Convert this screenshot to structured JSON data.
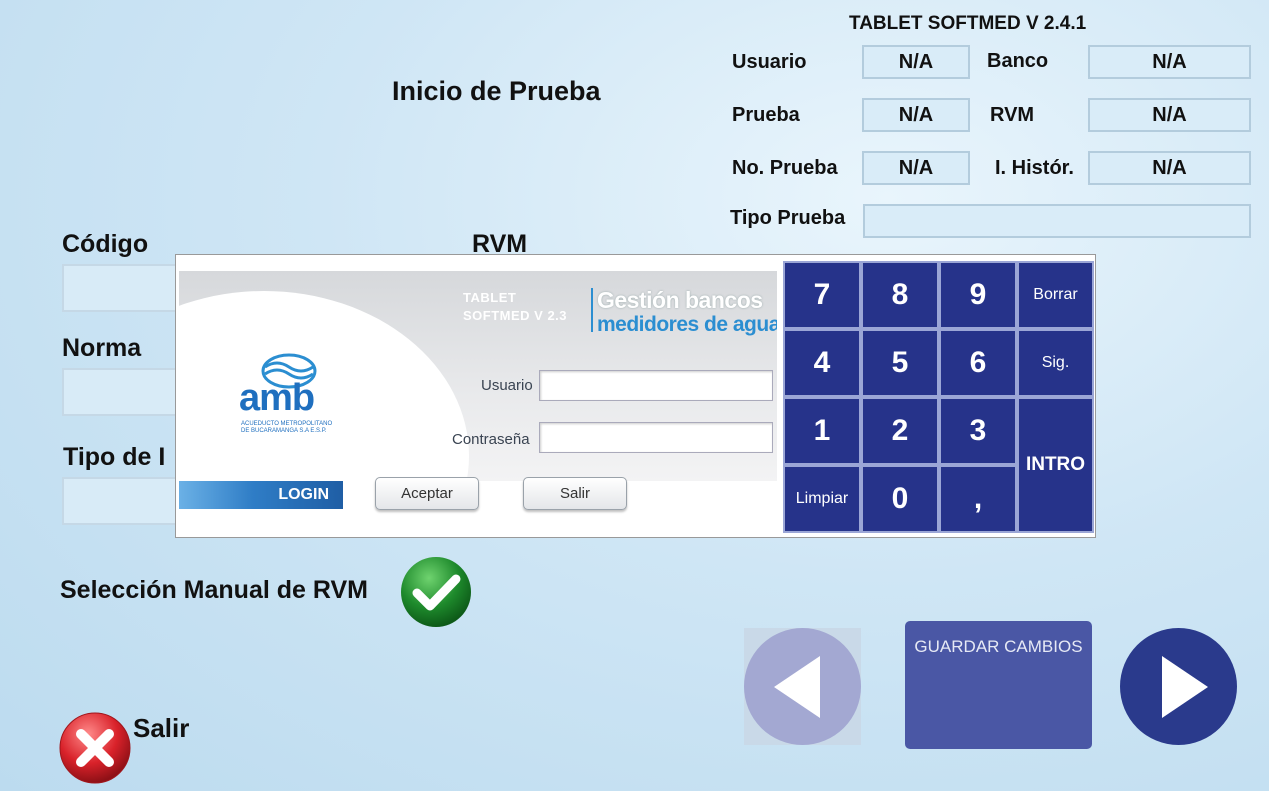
{
  "app_title": "TABLET SOFTMED V 2.4.1",
  "page_title": "Inicio de Prueba",
  "info": {
    "usuario_label": "Usuario",
    "usuario_value": "N/A",
    "banco_label": "Banco",
    "banco_value": "N/A",
    "prueba_label": "Prueba",
    "prueba_value": "N/A",
    "rvm_label": "RVM",
    "rvm_value": "N/A",
    "no_prueba_label": "No. Prueba",
    "no_prueba_value": "N/A",
    "i_historico_label": "I. Histór.",
    "i_historico_value": "N/A",
    "tipo_prueba_label": "Tipo Prueba",
    "tipo_prueba_value": ""
  },
  "form": {
    "codigo_label": "Código",
    "rvm_label": "RVM",
    "norma_label": "Norma",
    "tipo_label": "Tipo de I"
  },
  "login": {
    "header_text_1": "TABLET",
    "header_text_2": "SOFTMED V 2.3",
    "brand_line1": "Gestión bancos",
    "brand_line2": "medidores de agua",
    "logo_text": "amb",
    "logo_subtext_1": "ACUEDUCTO METROPOLITANO",
    "logo_subtext_2": "DE BUCARAMANGA S.A E.S.P.",
    "usuario_label": "Usuario",
    "usuario_value": "",
    "contrasena_label": "Contraseña",
    "contrasena_value": "",
    "tag": "LOGIN",
    "aceptar_label": "Aceptar",
    "salir_label": "Salir"
  },
  "keypad": {
    "k7": "7",
    "k8": "8",
    "k9": "9",
    "borrar": "Borrar",
    "k4": "4",
    "k5": "5",
    "k6": "6",
    "sig": "Sig.",
    "k1": "1",
    "k2": "2",
    "k3": "3",
    "intro": "INTRO",
    "limpiar": "Limpiar",
    "k0": "0",
    "comma": ","
  },
  "manual_rvm_label": "Selección Manual de RVM",
  "salir_label": "Salir",
  "guardar_label": "GUARDAR CAMBIOS",
  "colors": {
    "keypad_blue": "#26338a",
    "guardar_bg": "#4a57a5",
    "next_circle": "#2a3a8c",
    "prev_circle": "#a3a8d2",
    "check_green": "#1e8a2c",
    "close_red": "#d9222a"
  },
  "icons": {
    "check": "check-icon",
    "close": "close-icon",
    "prev": "arrow-left-icon",
    "next": "arrow-right-icon"
  }
}
